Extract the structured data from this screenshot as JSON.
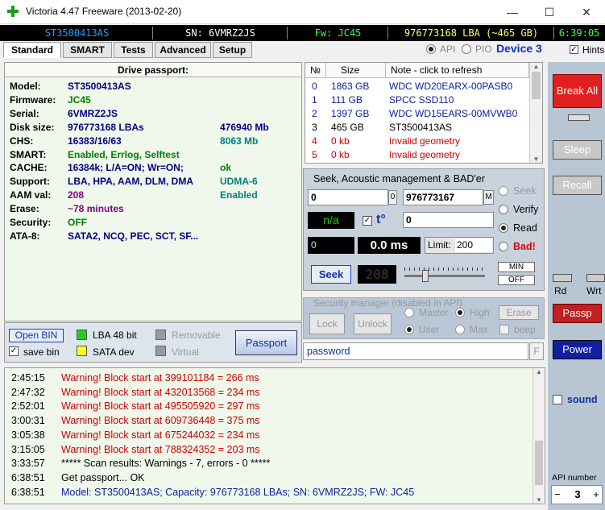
{
  "window": {
    "title": "Victoria 4.47  Freeware (2013-02-20)"
  },
  "status": {
    "model": "ST3500413AS",
    "sn": "SN: 6VMRZ2JS",
    "fw": "Fw: JC45",
    "lba": "976773168 LBA (~465 GB)",
    "clock": "6:39:05"
  },
  "tabs": [
    "Standard",
    "SMART",
    "Tests",
    "Advanced",
    "Setup"
  ],
  "mode": {
    "api_label": "API",
    "pio_label": "PIO",
    "device_label": "Device 3",
    "hints_label": "Hints"
  },
  "passport": {
    "header": "Drive passport:",
    "rows": [
      {
        "label": "Model:",
        "value": "ST3500413AS",
        "extra": "",
        "value_color": "#000080",
        "extra_color": "#000080"
      },
      {
        "label": "Firmware:",
        "value": "JC45",
        "extra": "",
        "value_color": "#008000",
        "extra_color": "#000"
      },
      {
        "label": "Serial:",
        "value": "6VMRZ2JS",
        "extra": "",
        "value_color": "#000080",
        "extra_color": "#000"
      },
      {
        "label": "Disk size:",
        "value": "976773168 LBAs",
        "extra": "476940 Mb",
        "value_color": "#000080",
        "extra_color": "#000080"
      },
      {
        "label": "CHS:",
        "value": "16383/16/63",
        "extra": "8063 Mb",
        "value_color": "#000080",
        "extra_color": "#008080"
      },
      {
        "label": "SMART:",
        "value": "Enabled, Errlog, Selftest",
        "extra": "",
        "value_color": "#008000",
        "extra_color": "#000"
      },
      {
        "label": "CACHE:",
        "value": "16384k; L/A=ON; Wr=ON;",
        "extra": "ok",
        "value_color": "#000080",
        "extra_color": "#008000"
      },
      {
        "label": "Support:",
        "value": "LBA, HPA, AAM, DLM, DMA",
        "extra": "UDMA-6",
        "value_color": "#000080",
        "extra_color": "#008080"
      },
      {
        "label": "AAM val:",
        "value": "208",
        "extra": "Enabled",
        "value_color": "#800080",
        "extra_color": "#008080"
      },
      {
        "label": "Erase:",
        "value": "~78 minutes",
        "extra": "",
        "value_color": "#800080",
        "extra_color": "#000"
      },
      {
        "label": "Security:",
        "value": "OFF",
        "extra": "",
        "value_color": "#008000",
        "extra_color": "#000"
      },
      {
        "label": "ATA-8:",
        "value": "SATA2, NCQ, PEC, SCT, SF...",
        "extra": "",
        "value_color": "#000080",
        "extra_color": "#000"
      }
    ],
    "open_bin": "Open BIN",
    "save_bin": "save bin",
    "lba48": "LBA 48 bit",
    "sata_dev": "SATA dev",
    "removable": "Removable",
    "virtual": "Virtual",
    "passport_button": "Passport"
  },
  "drives": {
    "headers": [
      "№",
      "Size",
      "Note - click to refresh"
    ],
    "rows": [
      {
        "n": "0",
        "size": "1863 GB",
        "note": "WDC WD20EARX-00PASB0",
        "color": "#1020a0"
      },
      {
        "n": "1",
        "size": "111 GB",
        "note": "SPCC SSD110",
        "color": "#1020a0"
      },
      {
        "n": "2",
        "size": "1397 GB",
        "note": "WDC WD15EARS-00MVWB0",
        "color": "#1020a0"
      },
      {
        "n": "3",
        "size": "465 GB",
        "note": "ST3500413AS",
        "color": "#000000"
      },
      {
        "n": "4",
        "size": "0 kb",
        "note": "Invalid geometry",
        "color": "#cc0000"
      },
      {
        "n": "5",
        "size": "0 kb",
        "note": "Invalid geometry",
        "color": "#cc0000"
      }
    ]
  },
  "seek": {
    "title": "Seek, Acoustic management & BAD'er",
    "start": "0",
    "start_suffix": "0",
    "end": "976773167",
    "end_suffix": "M",
    "na": "n/a",
    "t_label": "t°",
    "field2": "0",
    "field3": "0",
    "ms": "0.0 ms",
    "limit_label": "Limit:",
    "limit": "200",
    "seek_button": "Seek",
    "lcd": "208",
    "min": "MIN",
    "off": "OFF",
    "opt_seek": "Seek",
    "opt_verify": "Verify",
    "opt_read": "Read",
    "opt_bad": "Bad!"
  },
  "security": {
    "title": "Security manager (disabled in API)",
    "lock": "Lock",
    "unlock": "Unlock",
    "master": "Master",
    "user": "User",
    "high": "High",
    "max": "Max",
    "erase": "Erase",
    "beep": "beep",
    "password_placeholder": "password",
    "f": "F"
  },
  "right": {
    "break_all": "Break All",
    "sleep": "Sleep",
    "recall": "Recall",
    "rd": "Rd",
    "wrt": "Wrt",
    "passp": "Passp",
    "power": "Power",
    "sound": "sound",
    "api_number_label": "API number",
    "api_number": "3",
    "minus": "−",
    "plus": "+"
  },
  "log": [
    {
      "time": "2:45:15",
      "text": "Warning! Block start at 399101184 = 266 ms",
      "cls": "red"
    },
    {
      "time": "2:47:32",
      "text": "Warning! Block start at 432013568 = 234 ms",
      "cls": "red"
    },
    {
      "time": "2:52:01",
      "text": "Warning! Block start at 495505920 = 297 ms",
      "cls": "red"
    },
    {
      "time": "3:00:31",
      "text": "Warning! Block start at 609736448 = 375 ms",
      "cls": "red"
    },
    {
      "time": "3:05:38",
      "text": "Warning! Block start at 675244032 = 234 ms",
      "cls": "red"
    },
    {
      "time": "3:15:05",
      "text": "Warning! Block start at 788324352 = 203 ms",
      "cls": "red"
    },
    {
      "time": "3:33:57",
      "text": "***** Scan results: Warnings - 7, errors - 0 *****",
      "cls": ""
    },
    {
      "time": "6:38:51",
      "text": "Get passport... OK",
      "cls": ""
    },
    {
      "time": "6:38:51",
      "text": "Model: ST3500413AS; Capacity: 976773168 LBAs; SN: 6VMRZ2JS; FW: JC45",
      "cls": "blue"
    }
  ]
}
